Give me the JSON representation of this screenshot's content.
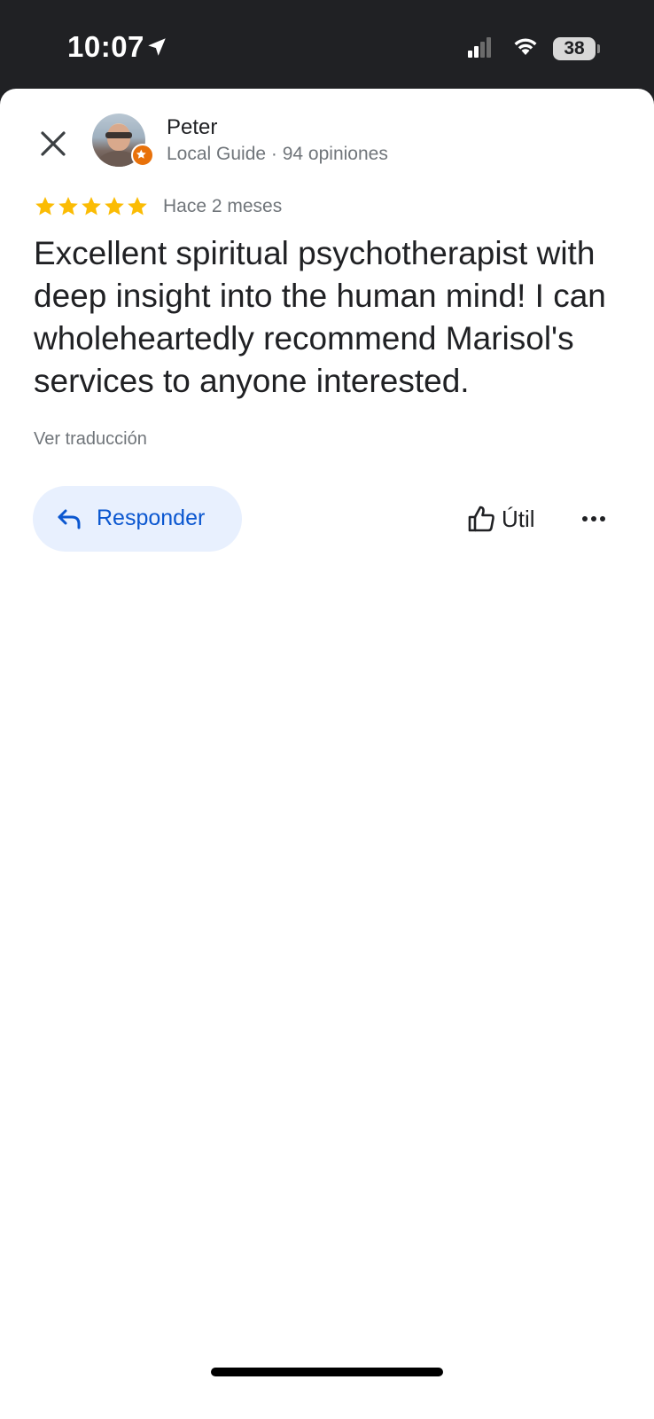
{
  "status_bar": {
    "time": "10:07",
    "battery": "38",
    "icons": [
      "location-arrow-icon",
      "cellular-signal-icon",
      "wifi-icon",
      "battery-icon"
    ]
  },
  "review": {
    "reviewer_name": "Peter",
    "reviewer_meta": "Local Guide · 94 opiniones",
    "rating": 5,
    "rating_max": 5,
    "date": "Hace 2 meses",
    "text": "Excellent spiritual psychotherapist with deep insight into the human mind! I can wholeheartedly recommend Marisol's services to anyone interested.",
    "translate_link": "Ver traducción"
  },
  "actions": {
    "reply_label": "Responder",
    "helpful_label": "Útil",
    "icons": [
      "close-icon",
      "reply-icon",
      "thumbs-up-icon",
      "more-icon"
    ]
  },
  "colors": {
    "status_bg": "#202124",
    "star": "#fbbc04",
    "reply_bg": "#e8f0fe",
    "reply_text": "#0b57d0",
    "guide_badge": "#e8710a"
  }
}
